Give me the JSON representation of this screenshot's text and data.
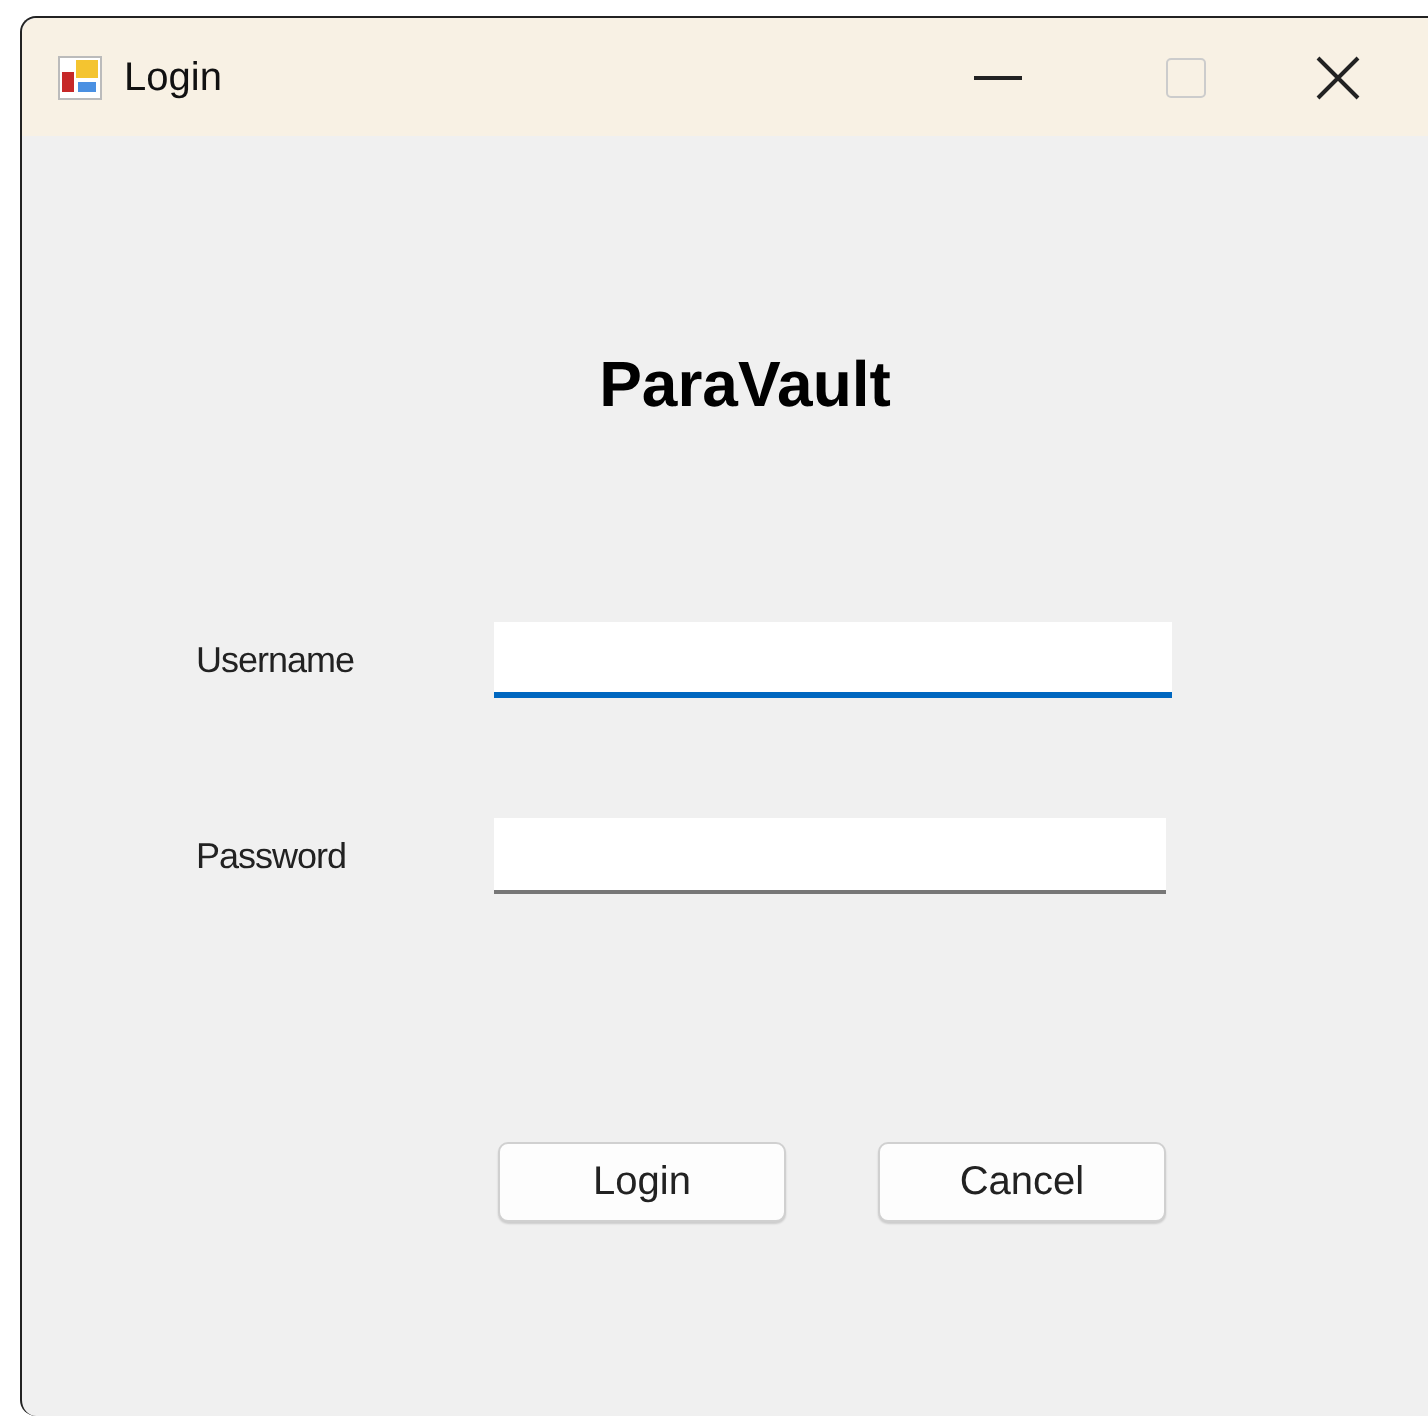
{
  "window": {
    "title": "Login"
  },
  "heading": "ParaVault",
  "fields": [
    {
      "label": "Username",
      "focused": true
    },
    {
      "label": "Password",
      "focused": false
    }
  ],
  "buttons": [
    "Login",
    "Cancel"
  ]
}
